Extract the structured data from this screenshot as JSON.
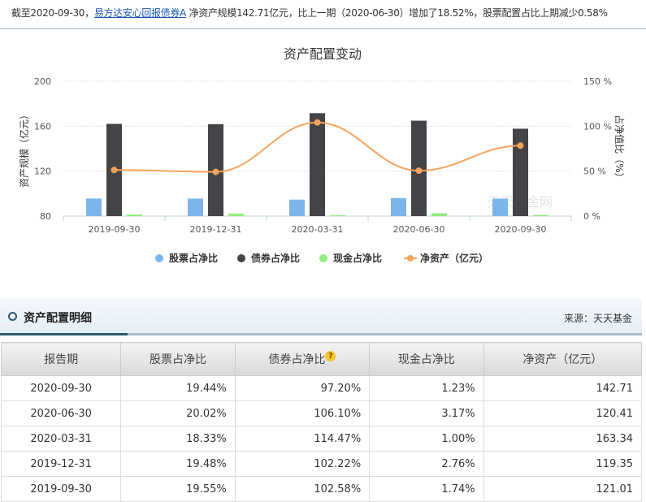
{
  "summary": {
    "prefix": "截至2020-09-30，",
    "fund_link": "易方达安心回报债券A",
    "text": "净资产规模142.71亿元，比上一期（2020-06-30）增加了18.52%，股票配置占比上期减少0.58%"
  },
  "chart_data": {
    "type": "bar",
    "title": "资产配置变动",
    "categories": [
      "2019-09-30",
      "2019-12-31",
      "2020-03-31",
      "2020-06-30",
      "2020-09-30"
    ],
    "ylabel": "资产规模（亿元）",
    "y2label": "占净值比（%）",
    "ylim": [
      80,
      200
    ],
    "yticks": [
      "200",
      "160",
      "120",
      "80"
    ],
    "y2lim": [
      0,
      150
    ],
    "y2ticks": [
      "150 %",
      "100 %",
      "50 %",
      "0 %"
    ],
    "series": [
      {
        "name": "股票占净比",
        "type": "bar",
        "axis": "right",
        "color": "#7cb5ec",
        "values": [
          19.55,
          19.48,
          18.33,
          20.02,
          19.44
        ]
      },
      {
        "name": "债券占净比",
        "type": "bar",
        "axis": "right",
        "color": "#434348",
        "values": [
          102.58,
          102.22,
          114.47,
          106.1,
          97.2
        ]
      },
      {
        "name": "现金占净比",
        "type": "bar",
        "axis": "right",
        "color": "#90ed7d",
        "values": [
          1.74,
          2.76,
          1.0,
          3.17,
          1.23
        ]
      },
      {
        "name": "净资产（亿元）",
        "type": "line",
        "axis": "left",
        "color": "#f7a35c",
        "values": [
          121.01,
          119.35,
          163.34,
          120.41,
          142.71
        ]
      }
    ],
    "watermark": "天天基金网",
    "legend": "bottom"
  },
  "panel": {
    "title": "资产配置明细",
    "source": "来源：天天基金"
  },
  "table": {
    "headers": [
      "报告期",
      "股票占净比",
      "债券占净比",
      "现金占净比",
      "净资产（亿元）"
    ],
    "help": "?",
    "rows": [
      [
        "2020-09-30",
        "19.44%",
        "97.20%",
        "1.23%",
        "142.71"
      ],
      [
        "2020-06-30",
        "20.02%",
        "106.10%",
        "3.17%",
        "120.41"
      ],
      [
        "2020-03-31",
        "18.33%",
        "114.47%",
        "1.00%",
        "163.34"
      ],
      [
        "2019-12-31",
        "19.48%",
        "102.22%",
        "2.76%",
        "119.35"
      ],
      [
        "2019-09-30",
        "19.55%",
        "102.58%",
        "1.74%",
        "121.01"
      ]
    ]
  }
}
